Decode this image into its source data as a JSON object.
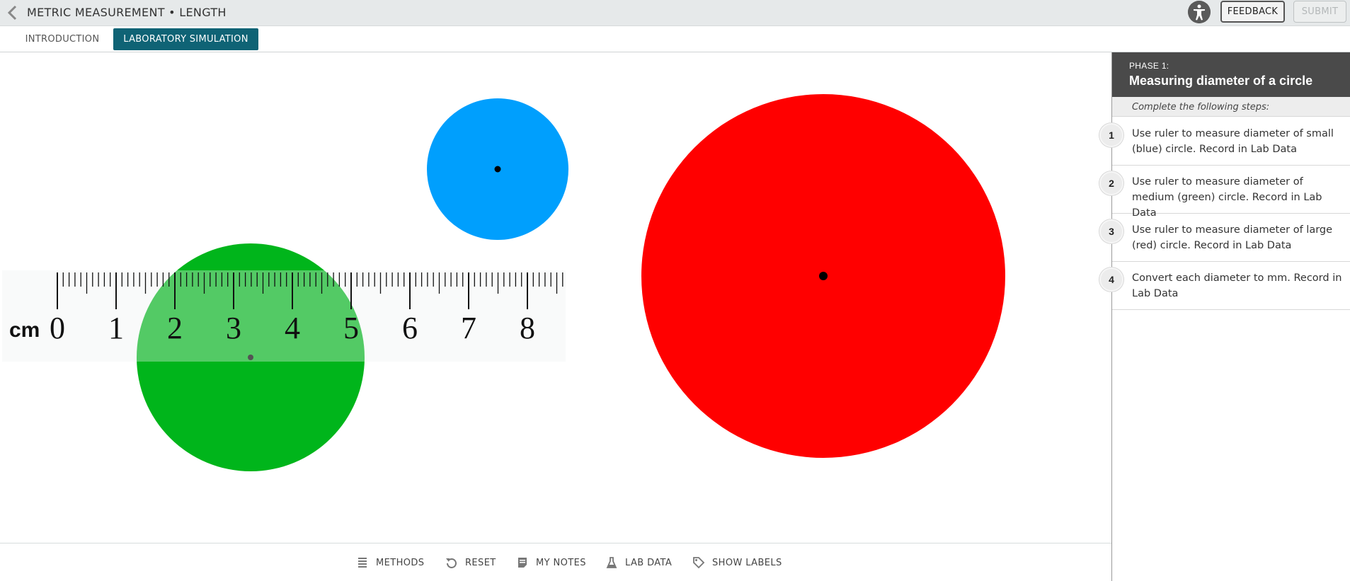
{
  "header": {
    "title": "METRIC MEASUREMENT • LENGTH",
    "feedback_label": "FEEDBACK",
    "submit_label": "SUBMIT"
  },
  "tabs": [
    {
      "label": "INTRODUCTION",
      "active": false
    },
    {
      "label": "LABORATORY SIMULATION",
      "active": true
    }
  ],
  "ruler": {
    "unit_label": "cm",
    "numbers": [
      "0",
      "1",
      "2",
      "3",
      "4",
      "5",
      "6",
      "7",
      "8"
    ],
    "max_cm": 8.6
  },
  "circles": [
    {
      "name": "blue-circle",
      "color": "#009ffd"
    },
    {
      "name": "green-circle",
      "color": "#00b51b"
    },
    {
      "name": "red-circle",
      "color": "#ff0000"
    }
  ],
  "panel": {
    "phase_label": "PHASE 1:",
    "phase_title": "Measuring diameter of a circle",
    "steps_intro": "Complete the following steps:",
    "steps": [
      {
        "num": "1",
        "text": "Use ruler to measure diameter of small (blue) circle. Record in Lab Data"
      },
      {
        "num": "2",
        "text": "Use ruler to measure diameter of medium (green) circle. Record in Lab Data"
      },
      {
        "num": "3",
        "text": "Use ruler to measure diameter of large (red) circle. Record in Lab Data"
      },
      {
        "num": "4",
        "text": "Convert each diameter to mm. Record in Lab Data"
      }
    ]
  },
  "toolbar": {
    "methods": "METHODS",
    "reset": "RESET",
    "notes": "MY NOTES",
    "lab_data": "LAB DATA",
    "show_labels": "SHOW LABELS"
  },
  "colors": {
    "accent": "#0f6375",
    "panel_header": "#4a4a4a"
  }
}
